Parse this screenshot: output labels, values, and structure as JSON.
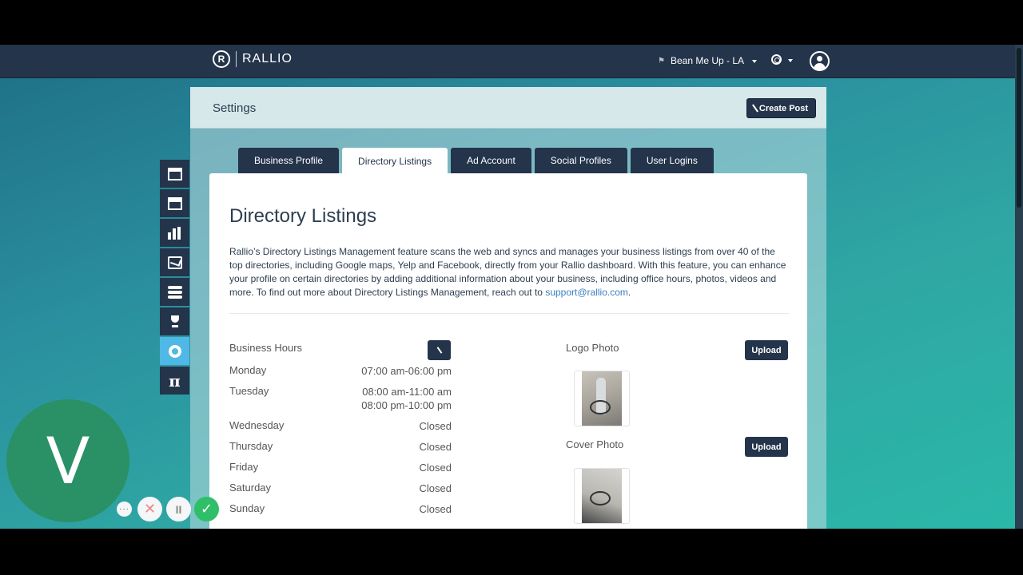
{
  "topbar": {
    "logo_mark": "R",
    "logo_text": "RALLIO",
    "location": "Bean Me Up - LA",
    "flag_icon": "flag-icon",
    "help_icon": "lifebuoy-icon",
    "avatar_icon": "user-avatar-icon"
  },
  "panel": {
    "title": "Settings",
    "create_post": "Create Post"
  },
  "tabs": [
    {
      "label": "Business Profile",
      "active": false
    },
    {
      "label": "Directory Listings",
      "active": true
    },
    {
      "label": "Ad Account",
      "active": false
    },
    {
      "label": "Social Profiles",
      "active": false
    },
    {
      "label": "User Logins",
      "active": false
    }
  ],
  "content": {
    "heading": "Directory Listings",
    "intro_text": "Rallio’s Directory Listings Management feature scans the web and syncs and manages your business listings from over 40 of the top directories, including Google maps, Yelp and Facebook, directly from your Rallio dashboard. With this feature, you can enhance your profile on certain directories by adding additional information about your business, including office hours, photos, videos and more. To find out more about Directory Listings Management, reach out to ",
    "intro_link": "support@rallio.com",
    "intro_end": ".",
    "business_hours_label": "Business Hours",
    "hours": [
      {
        "day": "Monday",
        "times": [
          "07:00 am-06:00 pm"
        ]
      },
      {
        "day": "Tuesday",
        "times": [
          "08:00 am-11:00 am",
          "08:00 pm-10:00 pm"
        ]
      },
      {
        "day": "Wednesday",
        "times": [
          "Closed"
        ]
      },
      {
        "day": "Thursday",
        "times": [
          "Closed"
        ]
      },
      {
        "day": "Friday",
        "times": [
          "Closed"
        ]
      },
      {
        "day": "Saturday",
        "times": [
          "Closed"
        ]
      },
      {
        "day": "Sunday",
        "times": [
          "Closed"
        ]
      }
    ],
    "logo_photo_label": "Logo Photo",
    "cover_photo_label": "Cover Photo",
    "upload_label": "Upload"
  },
  "sidebar": [
    {
      "icon": "storefront-icon",
      "active": false
    },
    {
      "icon": "calendar-icon",
      "active": false
    },
    {
      "icon": "bar-chart-icon",
      "active": false
    },
    {
      "icon": "message-icon",
      "active": false
    },
    {
      "icon": "database-icon",
      "active": false
    },
    {
      "icon": "trophy-icon",
      "active": false
    },
    {
      "icon": "gear-icon",
      "active": true
    },
    {
      "icon": "pi-icon",
      "active": false
    }
  ],
  "recorder": {
    "initial": "V",
    "more": "···",
    "cancel": "✕",
    "pause": "II",
    "done": "✓"
  }
}
